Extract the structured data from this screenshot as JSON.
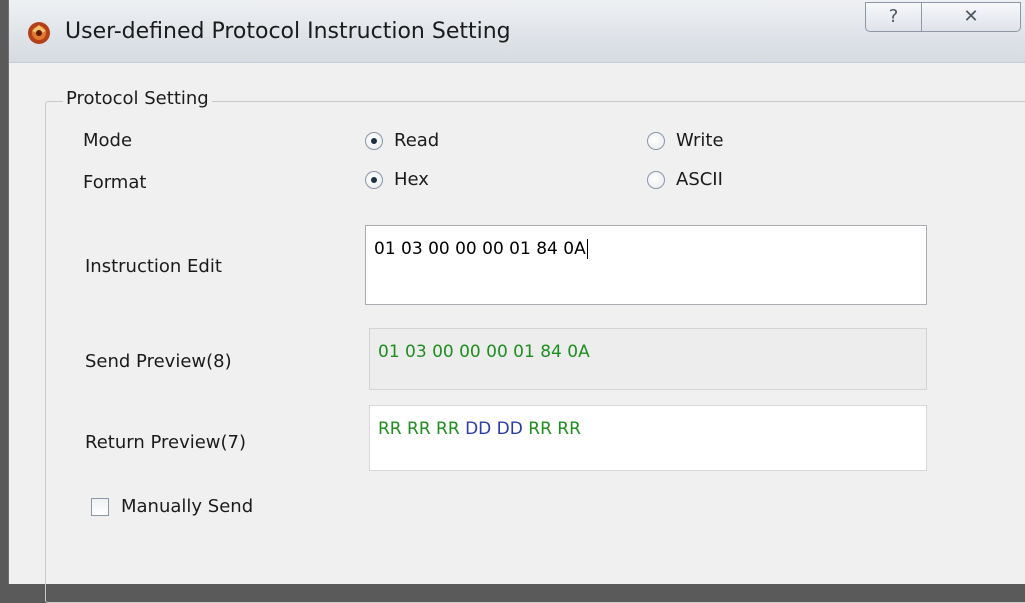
{
  "window": {
    "title": "User-defined Protocol Instruction Setting",
    "help_icon": "?",
    "close_icon": "✕"
  },
  "group": {
    "title": "Protocol Setting"
  },
  "mode": {
    "label": "Mode",
    "options": [
      {
        "label": "Read",
        "checked": true
      },
      {
        "label": "Write",
        "checked": false
      }
    ]
  },
  "format": {
    "label": "Format",
    "options": [
      {
        "label": "Hex",
        "checked": true
      },
      {
        "label": "ASCII",
        "checked": false
      }
    ]
  },
  "instruction_edit": {
    "label": "Instruction Edit",
    "value": "01 03 00 00 00 01 84 0A"
  },
  "send_preview": {
    "label": "Send Preview(8)",
    "value": "01 03 00 00 00 01 84 0A",
    "color": "#1e8e1e"
  },
  "return_preview": {
    "label": "Return Preview(7)",
    "tokens": [
      "RR",
      "RR",
      "RR",
      "DD",
      "DD",
      "RR",
      "RR"
    ],
    "token_colors": {
      "RR": "#1e8e1e",
      "DD": "#2d3ca8"
    }
  },
  "manual_send": {
    "label": "Manually Send",
    "checked": false
  }
}
